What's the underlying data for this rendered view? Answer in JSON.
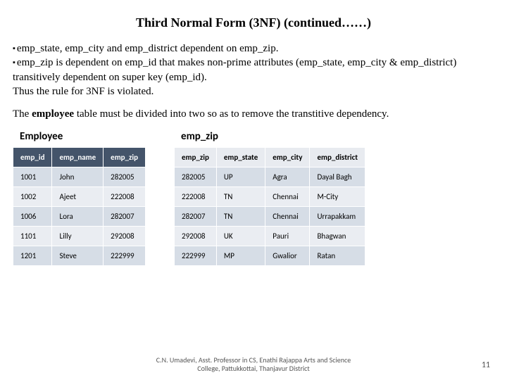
{
  "title": "Third Normal Form (3NF) (continued……)",
  "bullets": {
    "b1": "emp_state, emp_city  and emp_district dependent on emp_zip.",
    "b2": "emp_zip is dependent on emp_id that makes non-prime attributes (emp_state, emp_city & emp_district) transitively dependent on super key (emp_id).",
    "b3": "Thus the rule for 3NF is violated."
  },
  "divide": {
    "pre": "The ",
    "bold": "employee",
    "post": " table must be divided into two so as to remove the transtitive dependency."
  },
  "employee": {
    "label": "Employee",
    "headers": [
      "emp_id",
      "emp_name",
      "emp_zip"
    ],
    "rows": [
      [
        "1001",
        "John",
        "282005"
      ],
      [
        "1002",
        "Ajeet",
        "222008"
      ],
      [
        "1006",
        "Lora",
        "282007"
      ],
      [
        "1101",
        "Lilly",
        "292008"
      ],
      [
        "1201",
        "Steve",
        "222999"
      ]
    ]
  },
  "zip": {
    "label": "emp_zip",
    "headers": [
      "emp_zip",
      "emp_state",
      "emp_city",
      "emp_district"
    ],
    "rows": [
      [
        "282005",
        "UP",
        "Agra",
        "Dayal Bagh"
      ],
      [
        "222008",
        "TN",
        "Chennai",
        "M-City"
      ],
      [
        "282007",
        "TN",
        "Chennai",
        "Urrapakkam"
      ],
      [
        "292008",
        "UK",
        "Pauri",
        "Bhagwan"
      ],
      [
        "222999",
        "MP",
        "Gwalior",
        "Ratan"
      ]
    ]
  },
  "footer": {
    "credit": "C.N. Umadevi, Asst. Professor in CS, Enathi Rajappa Arts and Science College, Pattukkottai, Thanjavur District",
    "page": "11"
  }
}
